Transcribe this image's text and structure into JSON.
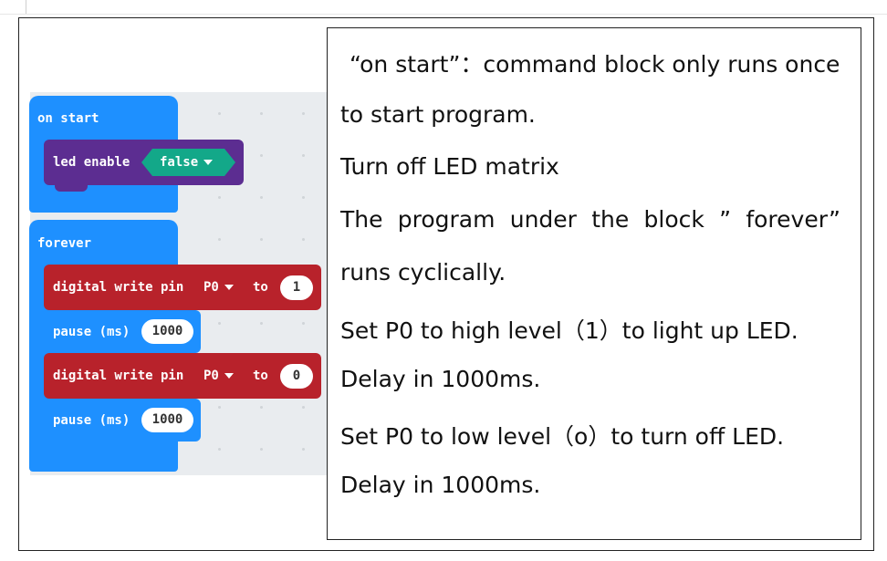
{
  "blocks": {
    "on_start": {
      "label": "on start",
      "led": {
        "label": "led enable",
        "value": "false"
      }
    },
    "forever": {
      "label": "forever",
      "write1": {
        "label": "digital write pin",
        "pin": "P0",
        "to": "to",
        "value": "1"
      },
      "pause1": {
        "label": "pause (ms)",
        "value": "1000"
      },
      "write2": {
        "label": "digital write pin",
        "pin": "P0",
        "to": "to",
        "value": "0"
      },
      "pause2": {
        "label": "pause (ms)",
        "value": "1000"
      }
    }
  },
  "explanation": {
    "lines": [
      "“on start”：command block only runs once",
      "to start program.",
      "Turn off LED matrix",
      "The program under the block ” forever”",
      "runs cyclically.",
      "Set P0 to high level（1）to light up LED.",
      "Delay in 1000ms.",
      "Set P0 to low level（o）to turn off LED.",
      "Delay in 1000ms."
    ]
  },
  "colors": {
    "basic_blue": "#1e90ff",
    "led_purple": "#5c2d91",
    "pins_red": "#b8222b",
    "logic_teal": "#13a889",
    "workspace_bg": "#e9ecef"
  }
}
